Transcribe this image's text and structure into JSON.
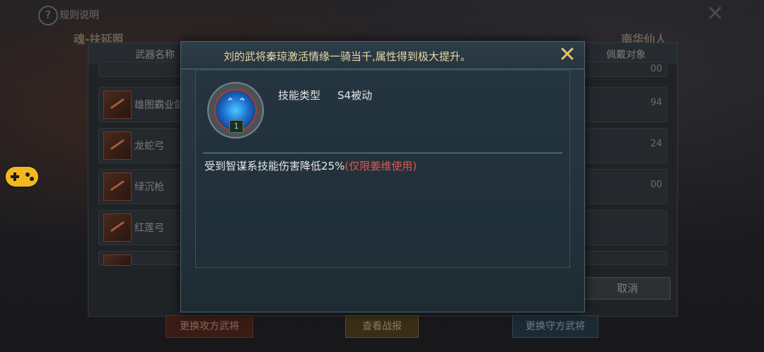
{
  "topbar": {
    "help_icon_glyph": "?",
    "rules_label": "规则说明",
    "close_glyph": "✕",
    "left_title": "魂-扶延照",
    "right_title": "南华仙人"
  },
  "weapon_list": {
    "col_name": "武器名称",
    "col_holder": "佩戴对象",
    "rows": [
      {
        "name": "",
        "num": "00"
      },
      {
        "name": "雄图霸业剑",
        "num": "94"
      },
      {
        "name": "龙蛇弓",
        "num": "24"
      },
      {
        "name": "绿沉枪",
        "num": "00"
      },
      {
        "name": "红莲弓",
        "num": ""
      },
      {
        "name": "",
        "num": ""
      }
    ],
    "cancel_label": "取消"
  },
  "bottom_buttons": {
    "replace_attack": "更换攻方武将",
    "view_report": "查看战报",
    "replace_defend": "更换守方武将"
  },
  "dialog": {
    "title": "刘的武将秦琼激活情缘一骑当千,属性得到极大提升。",
    "close_glyph": "✕",
    "skill_level": "1",
    "skill_type_label": "技能类型",
    "skill_type_value": "S4被动",
    "skill_description": "受到智谋系技能伤害降低25%",
    "skill_restriction": "(仅限姜维使用)"
  },
  "colors": {
    "accent_gold": "#e8c26a",
    "restriction_red": "#e2574c",
    "gamepad_yellow": "#f2b81e"
  },
  "icons": {
    "gamepad": "gamepad-icon",
    "skill": "blue-flame-skill-icon"
  }
}
